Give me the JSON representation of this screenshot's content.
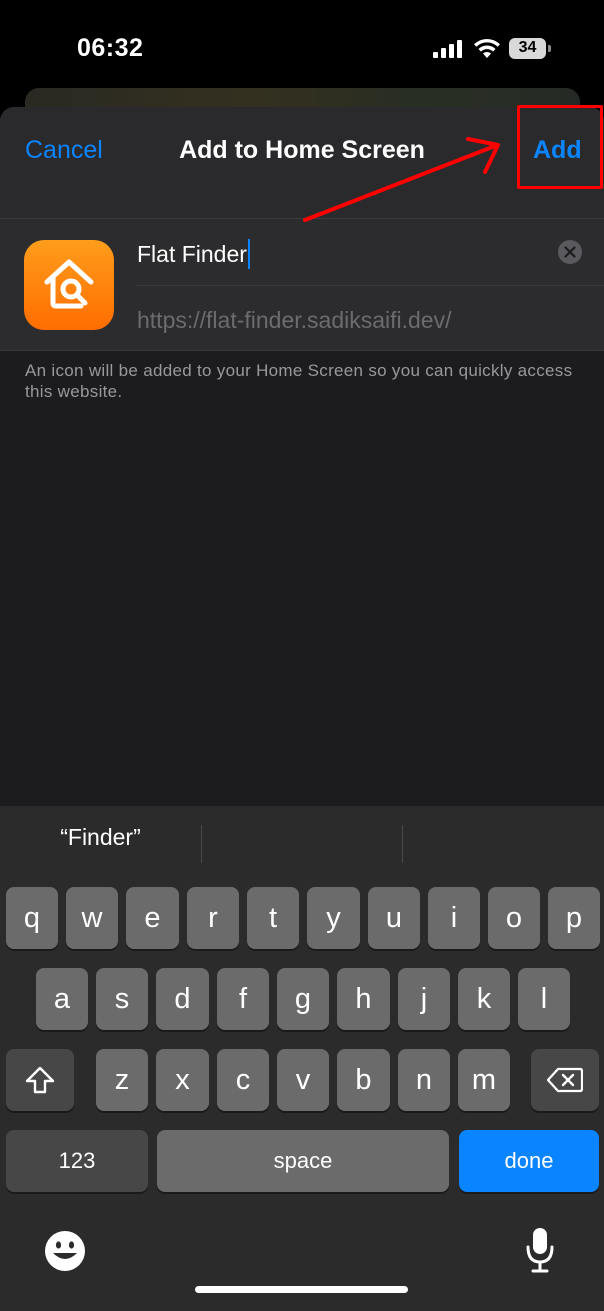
{
  "status_bar": {
    "time": "06:32",
    "battery": "34"
  },
  "sheet": {
    "cancel_label": "Cancel",
    "title": "Add to Home Screen",
    "add_label": "Add",
    "name_value": "Flat Finder",
    "url": "https://flat-finder.sadiksaifi.dev/",
    "info": "An icon will be added to your Home Screen so you can quickly access this website."
  },
  "keyboard": {
    "suggestions": [
      "“Finder”",
      "",
      ""
    ],
    "row1": [
      "q",
      "w",
      "e",
      "r",
      "t",
      "y",
      "u",
      "i",
      "o",
      "p"
    ],
    "row2": [
      "a",
      "s",
      "d",
      "f",
      "g",
      "h",
      "j",
      "k",
      "l"
    ],
    "row3": [
      "z",
      "x",
      "c",
      "v",
      "b",
      "n",
      "m"
    ],
    "numbers_label": "123",
    "space_label": "space",
    "done_label": "done"
  },
  "icons": [
    "signal-icon",
    "wifi-icon",
    "battery-icon",
    "house-search-icon",
    "clear-icon",
    "shift-icon",
    "backspace-icon",
    "emoji-icon",
    "microphone-icon"
  ],
  "colors": {
    "accent": "#0a84ff",
    "app_icon": "#ff7a00",
    "annotation": "#ff0000"
  }
}
